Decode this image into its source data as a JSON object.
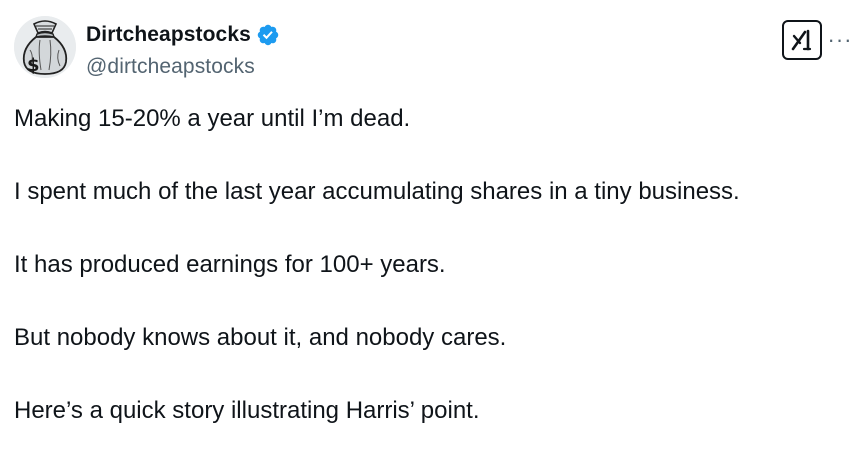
{
  "author": {
    "display_name": "Dirtcheapstocks",
    "handle": "@dirtcheapstocks",
    "verified": true,
    "avatar_icon": "money-bag-icon",
    "verified_color": "#1d9bf0"
  },
  "actions": {
    "grok_icon": "grok-icon",
    "more_label": "···"
  },
  "tweet": {
    "paragraphs": [
      "Making 15-20% a year until I’m dead.",
      "I spent much of the last year accumulating shares in a tiny business.",
      "It has produced earnings for 100+ years.",
      "But nobody knows about it, and nobody cares.",
      "Here’s a quick story illustrating Harris’ point."
    ]
  },
  "colors": {
    "text": "#0f1419",
    "secondary_text": "#536471",
    "background": "#ffffff"
  }
}
